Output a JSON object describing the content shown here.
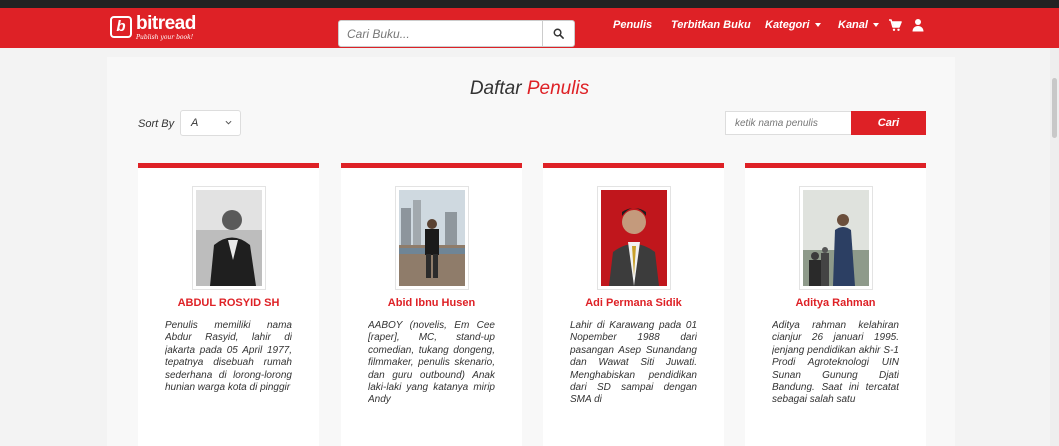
{
  "brand": {
    "name": "bitread",
    "tagline": "Publish your book!",
    "accent": "#de2126"
  },
  "search": {
    "placeholder": "Cari Buku..."
  },
  "nav": {
    "links": [
      "Penulis",
      "Terbitkan Buku"
    ],
    "kategori": "Kategori",
    "kanal": "Kanal"
  },
  "page": {
    "title_part1": "Daftar ",
    "title_part2": "Penulis",
    "sort_label": "Sort By",
    "sort_value": "A",
    "author_search_placeholder": "ketik nama penulis",
    "search_button": "Cari"
  },
  "authors": [
    {
      "name": "ABDUL ROSYID SH",
      "bio": "Penulis memiliki nama Abdur Rasyid, lahir di jakarta pada 05 April 1977, tepatnya disebuah rumah sederhana di lorong-lorong hunian warga kota di pinggir"
    },
    {
      "name": "Abid Ibnu Husen",
      "bio": "AABOY (novelis, Em Cee [raper], MC, stand-up comedian, tukang dongeng, filmmaker, penulis skenario, dan guru outbound) Anak laki-laki yang katanya mirip Andy"
    },
    {
      "name": "Adi Permana Sidik",
      "bio": "Lahir di Karawang pada 01 Nopember 1988 dari pasangan Asep Sunandang dan Wawat Siti Juwati. Menghabiskan pendidikan dari SD sampai dengan SMA di"
    },
    {
      "name": "Aditya Rahman",
      "bio": "Aditya rahman kelahiran cianjur 26 januari 1995. jenjang pendidikan akhir S-1 Prodi Agroteknologi UIN Sunan Gunung Djati Bandung. Saat ini tercatat sebagai salah satu"
    }
  ]
}
